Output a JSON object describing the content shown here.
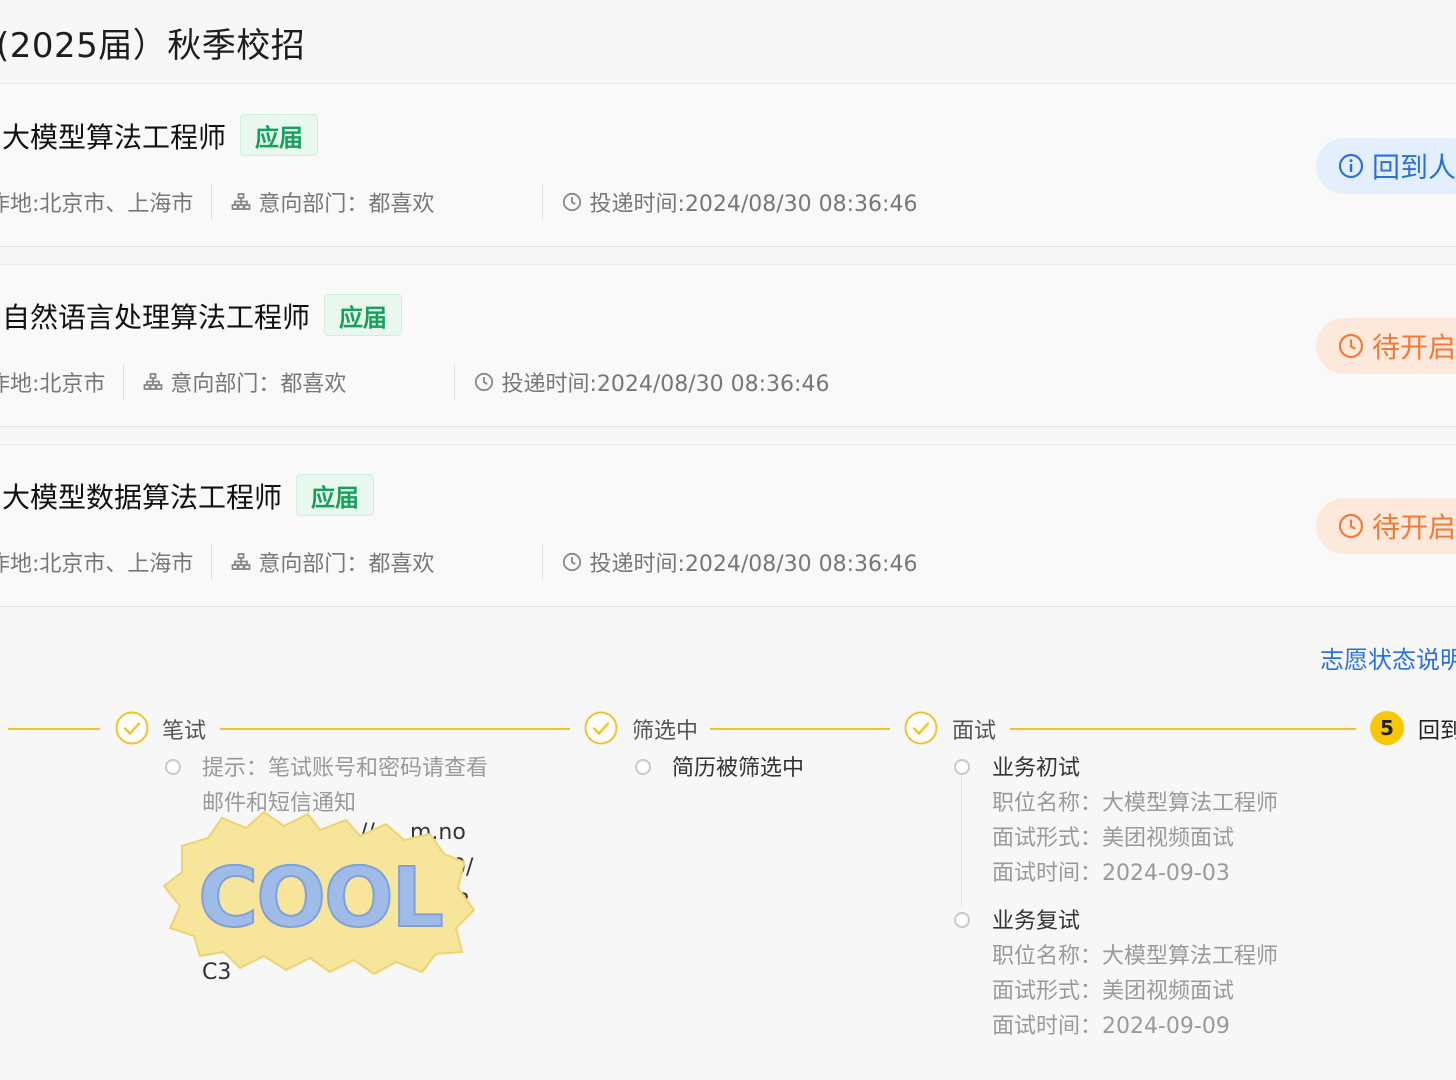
{
  "page": {
    "title": "(2025届）秋季校招"
  },
  "jobs": [
    {
      "title": "大模型算法工程师",
      "badge": "应届",
      "location": "作地:北京市、上海市",
      "department": "意向部门：都喜欢",
      "submit_time": "投递时间:2024/08/30 08:36:46",
      "status": "回到人才库",
      "status_color": "#2b72d8"
    },
    {
      "title": "自然语言处理算法工程师",
      "badge": "应届",
      "location": "作地:北京市",
      "department": "意向部门：都喜欢",
      "submit_time": "投递时间:2024/08/30 08:36:46",
      "status": "待开启",
      "status_color": "#f27a36"
    },
    {
      "title": "大模型数据算法工程师",
      "badge": "应届",
      "location": "作地:北京市、上海市",
      "department": "意向部门：都喜欢",
      "submit_time": "投递时间:2024/08/30 08:36:46",
      "status": "待开启",
      "status_color": "#f27a36"
    }
  ],
  "status_link": "志愿状态说明",
  "timeline": {
    "steps": [
      {
        "label": "笔试",
        "state": "done"
      },
      {
        "label": "筛选中",
        "state": "done"
      },
      {
        "label": "面试",
        "state": "done"
      },
      {
        "label": "回到",
        "state": "current",
        "number": "5"
      }
    ],
    "exam": {
      "hint_line1": "提示：笔试账号和密码请查看",
      "hint_line2": "邮件和短信通知",
      "url_fragment_1": "//c",
      "url_fragment_2": "m.no",
      "fragment_3": "0/",
      "fragment_4": "3",
      "fragment_5": "B",
      "fragment_6": "C3"
    },
    "screening": {
      "item": "简历被筛选中"
    },
    "interview": {
      "rounds": [
        {
          "name": "业务初试",
          "position": "职位名称：大模型算法工程师",
          "format": "面试形式：美团视频面试",
          "time": "面试时间：2024-09-03"
        },
        {
          "name": "业务复试",
          "position": "职位名称：大模型算法工程师",
          "format": "面试形式：美团视频面试",
          "time": "面试时间：2024-09-09"
        }
      ]
    }
  },
  "sticker": {
    "text": "COOL"
  },
  "colors": {
    "accent_yellow": "#f2c12e",
    "badge_green": "#16a05a",
    "link_blue": "#2b72d8",
    "pending_orange": "#f27a36"
  }
}
